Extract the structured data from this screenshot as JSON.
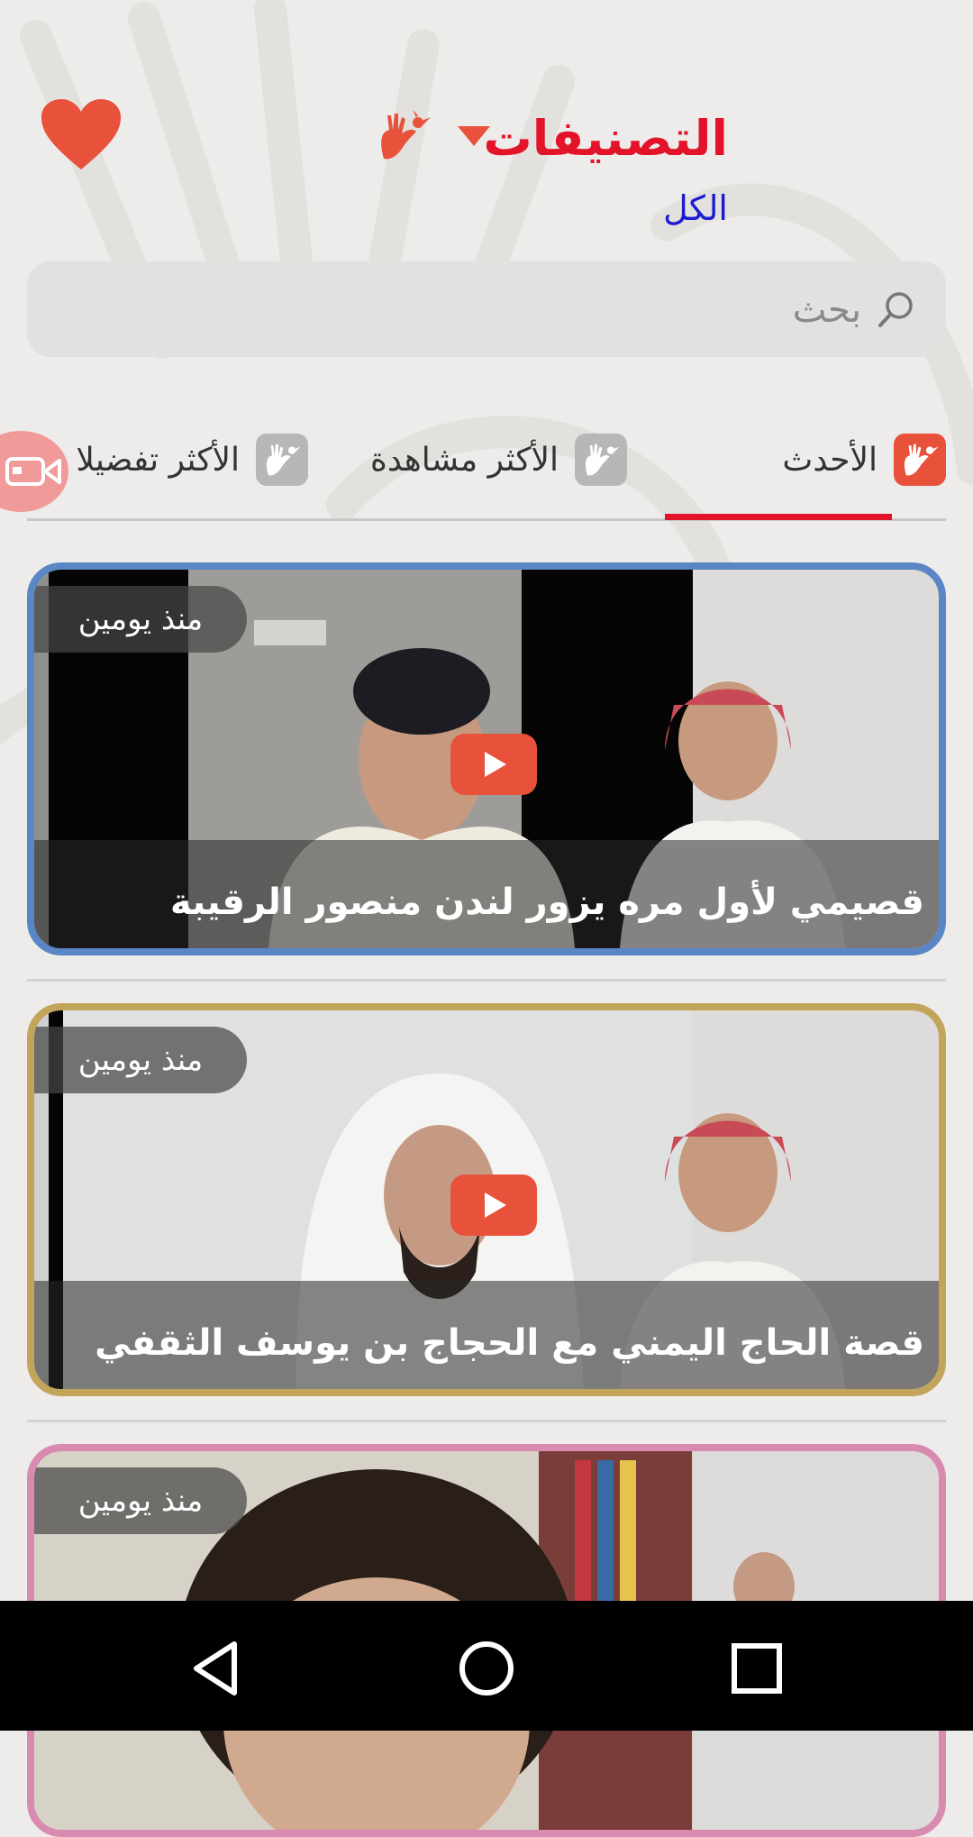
{
  "header": {
    "title": "التصنيفات",
    "subtitle": "الكل"
  },
  "search": {
    "placeholder": "بحث"
  },
  "tabs": [
    {
      "label": "الأحدث",
      "active": true
    },
    {
      "label": "الأكثر مشاهدة",
      "active": false
    },
    {
      "label": "الأكثر تفضيلا",
      "active": false
    }
  ],
  "videos": [
    {
      "title": "قصيمي لأول مره يزور لندن منصور الرقيبة",
      "time": "منذ يومين",
      "border_color": "#5b86c6"
    },
    {
      "title": "قصة الحاج اليمني مع الحجاج بن يوسف الثقفي",
      "time": "منذ يومين",
      "border_color": "#c2a45a"
    },
    {
      "title": "",
      "time": "منذ يومين",
      "border_color": "#d98ab0"
    }
  ],
  "colors": {
    "accent": "#e3142a",
    "subtitle": "#1b1bd6",
    "play": "#e8513a",
    "heart": "#e8513a"
  },
  "icons": [
    "heart-icon",
    "dropdown-arrow-icon",
    "hoopoe-hand-icon",
    "search-icon",
    "video-camera-icon",
    "play-icon",
    "back-icon",
    "home-icon",
    "recents-icon"
  ]
}
